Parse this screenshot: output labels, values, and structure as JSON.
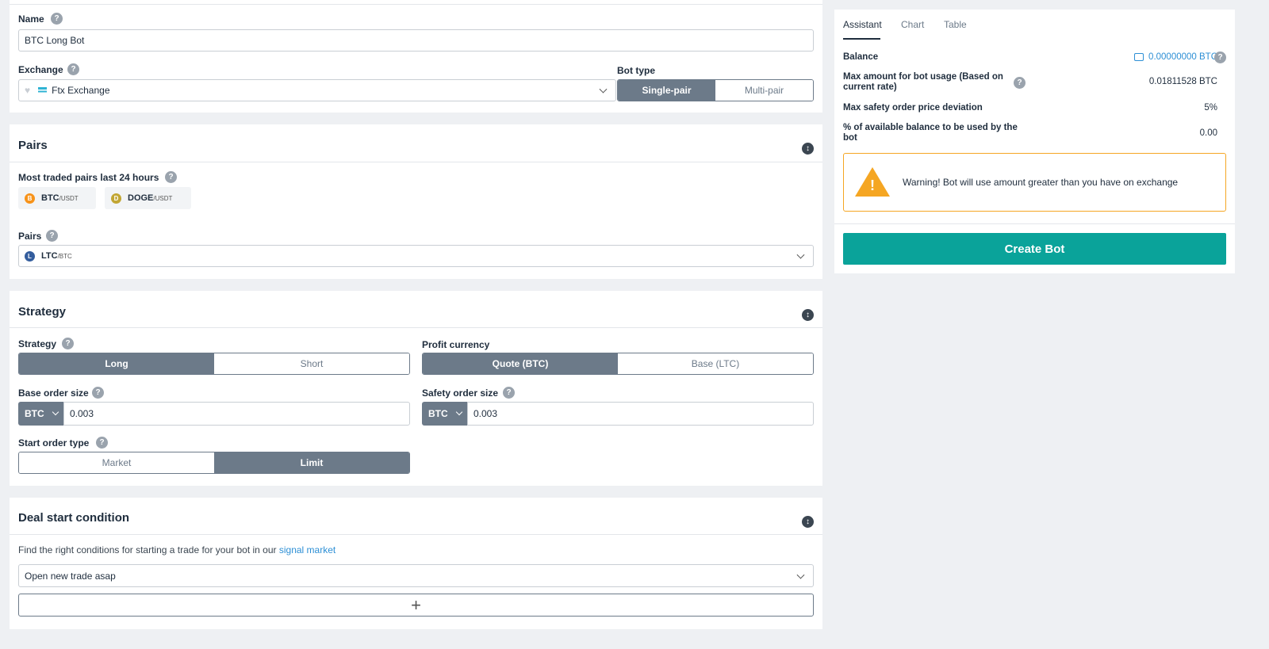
{
  "form": {
    "name_label": "Name",
    "name_value": "BTC Long Bot",
    "exchange_label": "Exchange",
    "exchange_value": "Ftx Exchange",
    "bot_type_label": "Bot type",
    "bot_type_options": [
      "Single-pair",
      "Multi-pair"
    ]
  },
  "pairs": {
    "title": "Pairs",
    "most_traded_label": "Most traded pairs last 24 hours",
    "chips": [
      {
        "base": "BTC",
        "quote": "/USDT",
        "color": "#f7931a",
        "glyph": "B"
      },
      {
        "base": "DOGE",
        "quote": "/USDT",
        "color": "#c2a633",
        "glyph": "D"
      }
    ],
    "pairs_label": "Pairs",
    "selected_base": "LTC",
    "selected_quote": "/BTC",
    "selected_color": "#345d9d",
    "selected_glyph": "L"
  },
  "strategy": {
    "title": "Strategy",
    "strategy_label": "Strategy",
    "strategy_options": [
      "Long",
      "Short"
    ],
    "profit_label": "Profit currency",
    "profit_options": [
      "Quote (BTC)",
      "Base (LTC)"
    ],
    "base_order_label": "Base order size",
    "base_order_currency": "BTC",
    "base_order_value": "0.003",
    "safety_order_label": "Safety order size",
    "safety_order_currency": "BTC",
    "safety_order_value": "0.003",
    "start_type_label": "Start order type",
    "start_type_options": [
      "Market",
      "Limit"
    ]
  },
  "deal": {
    "title": "Deal start condition",
    "desc": "Find the right conditions for starting a trade for your bot in our",
    "link": "signal market",
    "condition_value": "Open new trade asap",
    "add_symbol": "+"
  },
  "assistant": {
    "tabs": [
      "Assistant",
      "Chart",
      "Table"
    ],
    "balance_label": "Balance",
    "balance_value": "0.00000000 BTC",
    "max_amount_label": "Max amount for bot usage (Based on current rate)",
    "max_amount_value": "0.01811528 BTC",
    "max_dev_label": "Max safety order price deviation",
    "max_dev_value": "5%",
    "pct_label": "% of available balance to be used by the bot",
    "pct_value": "0.00",
    "warning": "Warning! Bot will use amount greater than you have on exchange",
    "create_button": "Create Bot"
  },
  "icons": {
    "help": "?",
    "collapse": "↕",
    "heart": "♥",
    "warning_mark": "!"
  },
  "colors": {
    "accent_teal": "#0aa39a",
    "segment_active": "#6c7a89",
    "warning_border": "#f5a623",
    "link_blue": "#2d8fd5"
  }
}
